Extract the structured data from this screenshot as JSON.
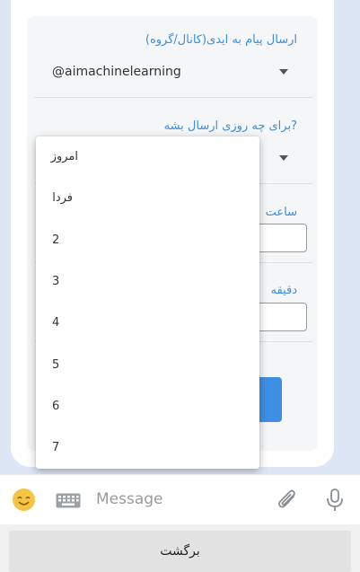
{
  "form": {
    "channel_label": "ارسال پیام به ایدی(کانال/گروه)",
    "channel_value": "@aimachinelearning",
    "day_label": "?برای چه روزی ارسال بشه",
    "hour_label": "ساعت",
    "minute_label": "دقیقه"
  },
  "dropdown": {
    "options": [
      "امروز",
      "فردا",
      "2",
      "3",
      "4",
      "5",
      "6",
      "7"
    ]
  },
  "message_bar": {
    "placeholder": "Message",
    "icons": [
      "smile-icon",
      "keyboard-icon",
      "attach-icon",
      "microphone-icon"
    ]
  },
  "footer": {
    "back_label": "برگشت"
  },
  "colors": {
    "accent": "#3d8ed4",
    "button": "#3e8fe3",
    "background": "#dde6f4",
    "emoji": "#f6c445"
  }
}
